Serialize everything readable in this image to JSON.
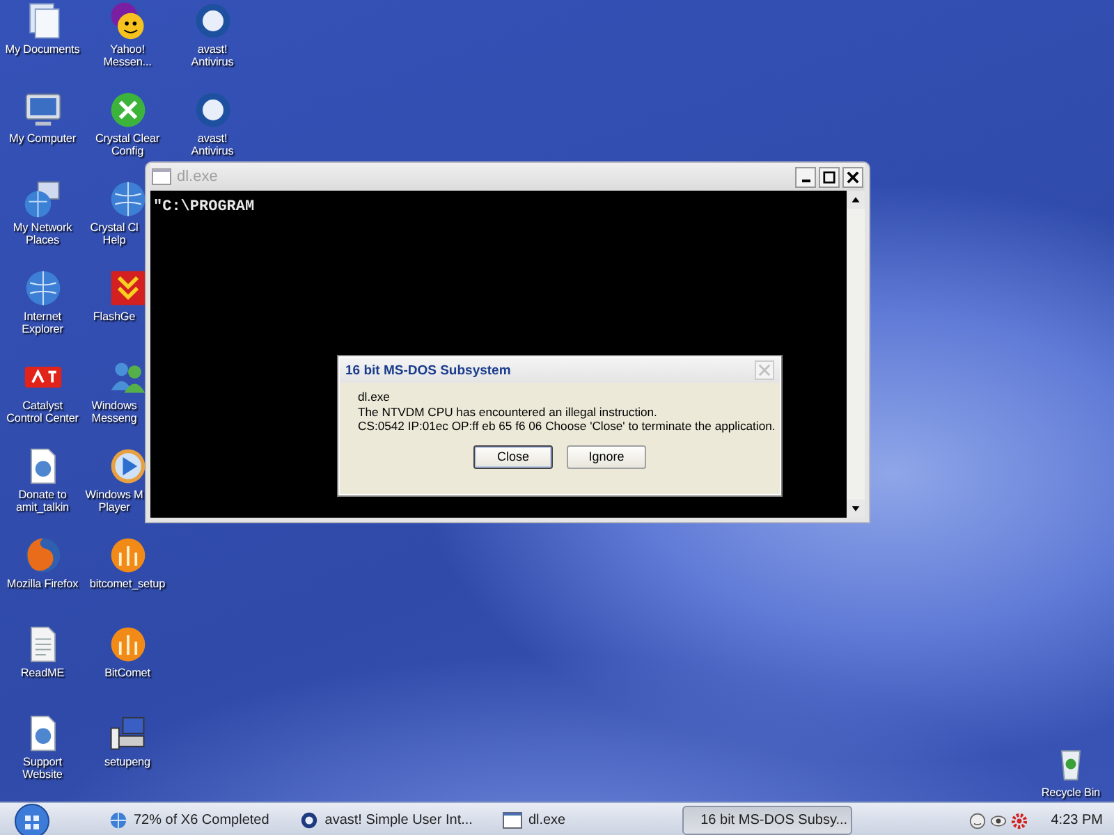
{
  "desktop_icons": [
    {
      "kind": "documents",
      "lines": [
        "My Documents"
      ]
    },
    {
      "kind": "computer",
      "lines": [
        "My Computer"
      ]
    },
    {
      "kind": "network",
      "lines": [
        "My Network",
        "Places"
      ]
    },
    {
      "kind": "ie",
      "lines": [
        "Internet",
        "Explorer"
      ]
    },
    {
      "kind": "ati",
      "lines": [
        "Catalyst",
        "Control Center"
      ]
    },
    {
      "kind": "webdoc",
      "lines": [
        "Donate to",
        "amit_talkin"
      ]
    },
    {
      "kind": "firefox",
      "lines": [
        "Mozilla Firefox"
      ]
    },
    {
      "kind": "textdoc",
      "lines": [
        "ReadME"
      ]
    },
    {
      "kind": "webdoc",
      "lines": [
        "Support",
        "Website"
      ]
    },
    {
      "kind": "yahoo",
      "lines": [
        "Yahoo!",
        "Messen..."
      ]
    },
    {
      "kind": "wrench",
      "lines": [
        "Crystal Clear",
        "Config"
      ]
    },
    {
      "kind": "globe",
      "lines": [
        "Crystal Cl",
        "Help"
      ]
    },
    {
      "kind": "flash",
      "lines": [
        "FlashGe"
      ]
    },
    {
      "kind": "people",
      "lines": [
        "Windows",
        "Messeng"
      ]
    },
    {
      "kind": "player",
      "lines": [
        "Windows M",
        "Player"
      ]
    },
    {
      "kind": "bitcomet",
      "lines": [
        "bitcomet_setup"
      ]
    },
    {
      "kind": "bitcomet",
      "lines": [
        "BitComet"
      ]
    },
    {
      "kind": "setup",
      "lines": [
        "setupeng"
      ]
    },
    {
      "kind": "avast",
      "lines": [
        "avast!",
        "Antivirus"
      ]
    },
    {
      "kind": "avast",
      "lines": [
        "avast!",
        "Antivirus"
      ]
    }
  ],
  "recycle_bin": {
    "label": "Recycle Bin"
  },
  "console_window": {
    "title": "dl.exe",
    "active": false,
    "output": "\"C:\\PROGRAM"
  },
  "dialog": {
    "title": "16 bit MS-DOS Subsystem",
    "lines": [
      "dl.exe",
      "The NTVDM CPU has encountered an illegal instruction.",
      "CS:0542 IP:01ec OP:ff eb 65 f6 06 Choose 'Close' to terminate the application."
    ],
    "buttons": [
      {
        "label": "Close",
        "focused": true
      },
      {
        "label": "Ignore",
        "focused": false
      }
    ]
  },
  "taskbar": {
    "tasks": [
      {
        "kind": "globe",
        "label": "72% of X6 Completed",
        "selected": false
      },
      {
        "kind": "avast",
        "label": "avast! Simple User Int...",
        "selected": false
      },
      {
        "kind": "window",
        "label": "dl.exe",
        "selected": false
      },
      {
        "kind": "window",
        "label": "16 bit MS-DOS Subsy...",
        "selected": true
      }
    ],
    "clock": "4:23 PM"
  }
}
